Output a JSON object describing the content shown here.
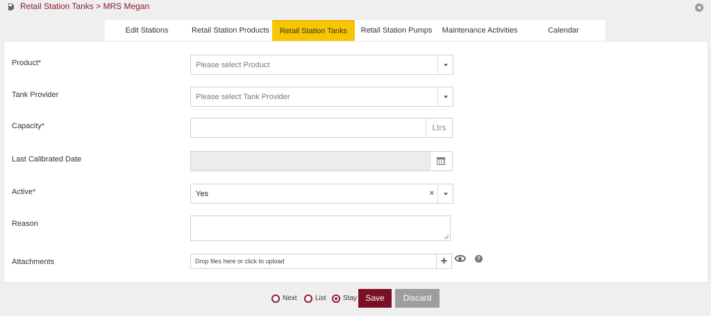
{
  "breadcrumb": {
    "text": "Retail Station Tanks > MRS Megan",
    "icon": "fuel-pump-icon"
  },
  "tabs": [
    {
      "label": "Edit Stations",
      "active": false
    },
    {
      "label": "Retail Station Products",
      "active": false
    },
    {
      "label": "Retail Station Tanks",
      "active": true
    },
    {
      "label": "Retail Station Pumps",
      "active": false
    },
    {
      "label": "Maintenance Activities",
      "active": false
    },
    {
      "label": "Calendar",
      "active": false
    }
  ],
  "form": {
    "product": {
      "label": "Product",
      "required": "*",
      "placeholder": "Please select Product"
    },
    "tank_provider": {
      "label": "Tank Provider",
      "placeholder": "Please select Tank Provider"
    },
    "capacity": {
      "label": "Capacity",
      "required": "*",
      "value": "",
      "unit": "Ltrs"
    },
    "last_calibrated": {
      "label": "Last Calibrated Date",
      "value": ""
    },
    "active": {
      "label": "Active",
      "required": "*",
      "value": "Yes",
      "clear": "×"
    },
    "reason": {
      "label": "Reason",
      "value": ""
    },
    "attachments": {
      "label": "Attachments",
      "placeholder": "Drop files here or click to upload",
      "plus": "+",
      "help": "?"
    }
  },
  "footer": {
    "next_label": "Next",
    "list_label": "List",
    "stay_label": "Stay",
    "selected": "Stay",
    "save_label": "Save",
    "discard_label": "Discard"
  },
  "colors": {
    "accent": "#7b0f24",
    "active_tab": "#f7c600",
    "discard": "#9d9d9d"
  }
}
